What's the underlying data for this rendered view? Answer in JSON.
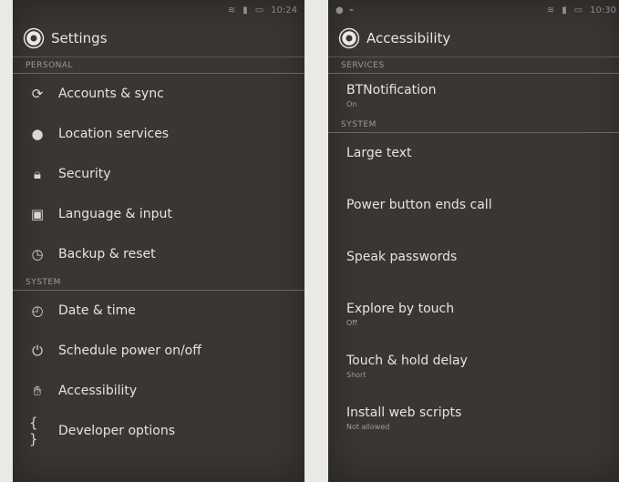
{
  "left": {
    "statusbar": {
      "time": "10:24"
    },
    "header": {
      "title": "Settings"
    },
    "personal_label": "PERSONAL",
    "personal_items": [
      {
        "label": "Accounts & sync",
        "icon": "sync-icon"
      },
      {
        "label": "Location services",
        "icon": "location-icon"
      },
      {
        "label": "Security",
        "icon": "lock-icon"
      },
      {
        "label": "Language & input",
        "icon": "keyboard-icon"
      },
      {
        "label": "Backup & reset",
        "icon": "backup-icon"
      }
    ],
    "system_label": "SYSTEM",
    "system_items": [
      {
        "label": "Date & time",
        "icon": "clock-icon"
      },
      {
        "label": "Schedule power on/off",
        "icon": "power-icon"
      },
      {
        "label": "Accessibility",
        "icon": "hand-icon"
      },
      {
        "label": "Developer options",
        "icon": "braces-icon"
      }
    ]
  },
  "right": {
    "statusbar": {
      "time": "10:30"
    },
    "header": {
      "title": "Accessibility"
    },
    "services_label": "SERVICES",
    "services": [
      {
        "label": "BTNotification",
        "sub": "On"
      }
    ],
    "system_label": "SYSTEM",
    "system_items": [
      {
        "label": "Large text",
        "sub": ""
      },
      {
        "label": "Power button ends call",
        "sub": ""
      },
      {
        "label": "Speak passwords",
        "sub": ""
      },
      {
        "label": "Explore by touch",
        "sub": "Off"
      },
      {
        "label": "Touch & hold delay",
        "sub": "Short"
      },
      {
        "label": "Install web scripts",
        "sub": "Not allowed"
      }
    ]
  }
}
